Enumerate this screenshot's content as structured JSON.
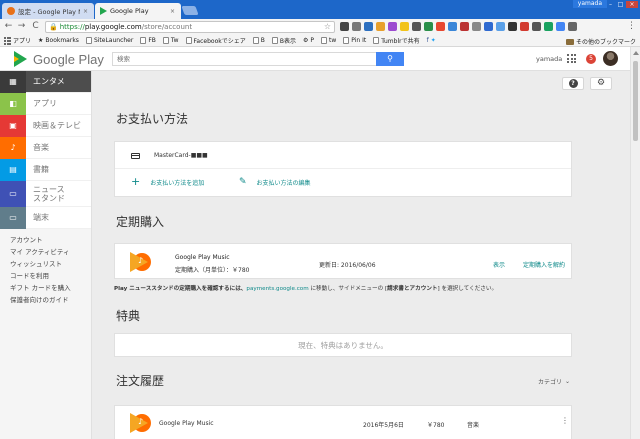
{
  "window": {
    "user": "yamada",
    "minimize": "–",
    "maximize": "□",
    "close": "×"
  },
  "tabs": [
    {
      "title": "設定 - Google Play Music",
      "close": "×"
    },
    {
      "title": "Google Play",
      "close": "×"
    }
  ],
  "toolbar": {
    "back": "←",
    "forward": "→",
    "reload": "C",
    "url_scheme": "https://",
    "url_host": "play.google.com",
    "url_path": "/store/account",
    "lock": "🔒",
    "star": "☆",
    "menu": "⋮"
  },
  "bookmarks": {
    "apps": "アプリ",
    "items": [
      "Bookmarks",
      "SiteLauncher",
      "FB",
      "Tw",
      "Facebookでシェア",
      "B",
      "B表示",
      "P",
      "tw",
      "Pin It",
      "Tumblrで共有"
    ],
    "other": "その他のブックマーク"
  },
  "header": {
    "logo_text": "Google Play",
    "search_placeholder": "検索",
    "search_icon": "⚲",
    "user": "yamada",
    "notifications": "5"
  },
  "sidebar": {
    "items": [
      {
        "label": "エンタメ",
        "icon": "▦",
        "color": "#4d4d4d"
      },
      {
        "label": "アプリ",
        "icon": "◧",
        "color": "#8bc34a"
      },
      {
        "label": "映画＆テレビ",
        "icon": "▣",
        "color": "#e53935"
      },
      {
        "label": "音楽",
        "icon": "♪",
        "color": "#ff6d00"
      },
      {
        "label": "書籍",
        "icon": "▤",
        "color": "#039be5"
      },
      {
        "label_line1": "ニュース",
        "label_line2": "スタンド",
        "icon": "▭",
        "color": "#3f51b5"
      },
      {
        "label": "端末",
        "icon": "▭",
        "color": "#607d8b"
      }
    ],
    "account_links": [
      "アカウント",
      "マイ アクティビティ",
      "ウィッシュリスト",
      "コードを利用",
      "ギフト カードを購入",
      "保護者向けのガイド"
    ]
  },
  "main": {
    "help_icon": "?",
    "gear_icon": "⚙",
    "payment": {
      "title": "お支払い方法",
      "card": "MasterCard-",
      "card_masked": "■■■",
      "add": "お支払い方法を追加",
      "add_icon": "+",
      "edit": "お支払い方法の編集",
      "edit_icon": "✎"
    },
    "subscriptions": {
      "title": "定期購入",
      "name": "Google Play Music",
      "plan": "定期購入（月単位）：￥780",
      "renew": "更新日: 2016/06/06",
      "view": "表示",
      "cancel": "定期購入を解約"
    },
    "note": {
      "bold1": "Play ニューススタンドの定期購入を確認するには、",
      "link": "payments.google.com",
      "text2": " に移動し、サイドメニューの [",
      "bold2": "請求書とアカウント",
      "text3": "] を選択してください。"
    },
    "perks": {
      "title": "特典",
      "empty": "現在、特典はありません。"
    },
    "orders": {
      "title": "注文履歴",
      "category": "カテゴリ",
      "category_icon": "⌄",
      "rows": [
        {
          "name": "Google Play Music",
          "date": "2016年5月6日",
          "price": "￥780",
          "type": "音楽",
          "menu": "⋮"
        }
      ]
    }
  }
}
